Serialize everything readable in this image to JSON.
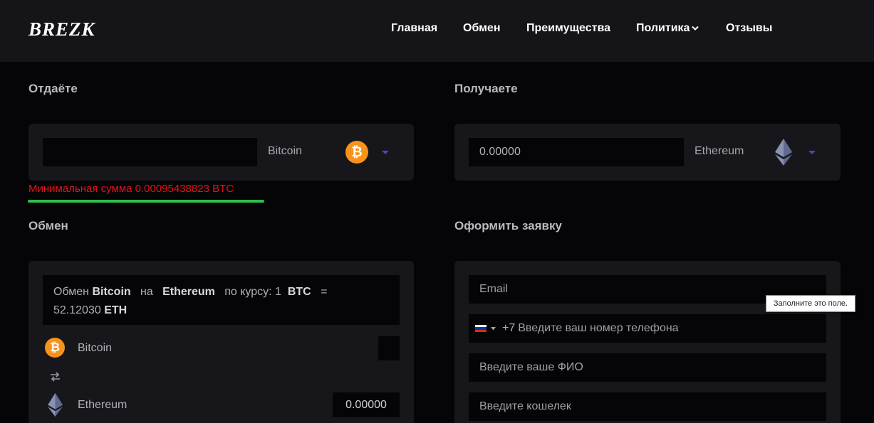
{
  "header": {
    "logo": "BREZK",
    "nav": [
      "Главная",
      "Обмен",
      "Преимущества",
      "Политика",
      "Отзывы"
    ]
  },
  "give": {
    "title": "Отдаёте",
    "amount_value": "",
    "currency": "Bitcoin",
    "currency_icon": "bitcoin-icon",
    "min_message": "Минимальная сумма 0.00095438823 BTC"
  },
  "receive": {
    "title": "Получаете",
    "amount_value": "0.00000",
    "currency": "Ethereum",
    "currency_icon": "ethereum-icon"
  },
  "exchange": {
    "title": "Обмен",
    "rate": {
      "prefix": "Обмен",
      "from": "Bitcoin",
      "on": "на",
      "to": "Ethereum",
      "rate_label": "по курсу: 1",
      "from_code": "BTC",
      "eq": "=",
      "value": "52.12030",
      "to_code": "ETH"
    },
    "from_row": {
      "name": "Bitcoin",
      "value": ""
    },
    "to_row": {
      "name": "Ethereum",
      "value": "0.00000"
    }
  },
  "order": {
    "title": "Оформить заявку",
    "email_placeholder": "Email",
    "phone_code": "+7",
    "phone_placeholder": "Введите ваш номер телефона",
    "name_placeholder": "Введите ваше ФИО",
    "wallet_placeholder": "Введите кошелек"
  },
  "tooltip": "Заполните это поле.",
  "colors": {
    "accent": "#5a3fc7",
    "error": "#e0151a",
    "success_line": "#2fbd4c",
    "bitcoin": "#f7931a"
  }
}
